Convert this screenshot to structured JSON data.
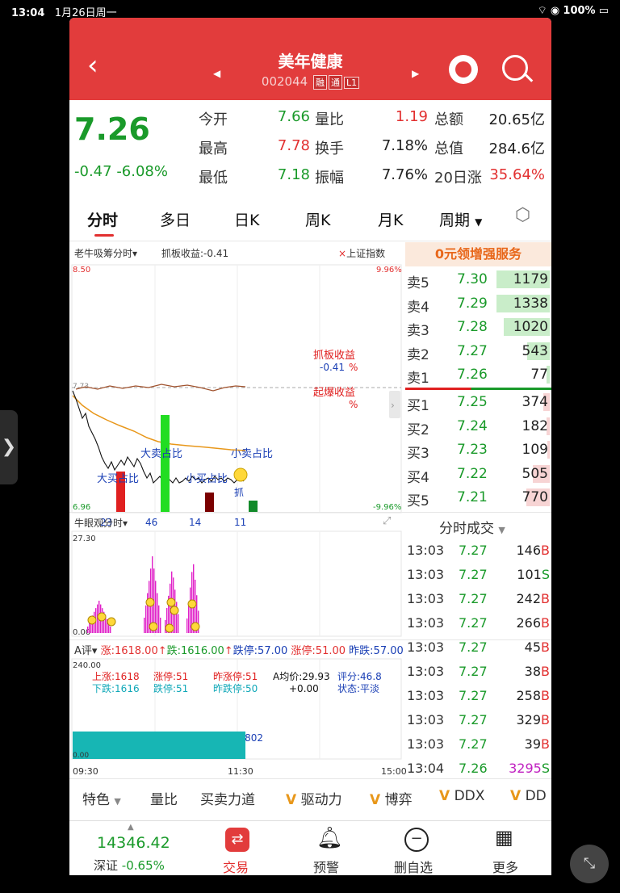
{
  "status_bar": {
    "time": "13:04",
    "date": "1月26日周一",
    "battery": "100%"
  },
  "header": {
    "title": "美年健康",
    "code": "002044",
    "badges": [
      "融",
      "通",
      "L1"
    ]
  },
  "quote": {
    "price": "7.26",
    "change": "-0.47",
    "change_pct": "-6.08%",
    "fields": [
      {
        "label": "今开",
        "value": "7.66",
        "color": "#1a9a2a"
      },
      {
        "label": "量比",
        "value": "1.19",
        "color": "#e23030"
      },
      {
        "label": "总额",
        "value": "20.65亿",
        "color": "#222222"
      },
      {
        "label": "最高",
        "value": "7.78",
        "color": "#e23030"
      },
      {
        "label": "换手",
        "value": "7.18%",
        "color": "#222222"
      },
      {
        "label": "总值",
        "value": "284.6亿",
        "color": "#222222"
      },
      {
        "label": "最低",
        "value": "7.18",
        "color": "#1a9a2a"
      },
      {
        "label": "振幅",
        "value": "7.76%",
        "color": "#222222"
      },
      {
        "label": "20日涨",
        "value": "35.64%",
        "color": "#e23030"
      }
    ]
  },
  "tabs": [
    "分时",
    "多日",
    "日K",
    "周K",
    "月K",
    "周期"
  ],
  "intraday": {
    "indicator_label": "老牛吸筹分时",
    "indicator_value": "抓板收益:-0.41",
    "index_label": "上证指数",
    "y_top": "8.50",
    "y_bottom": "6.96",
    "pct_top": "9.96%",
    "pct_bottom": "-9.96%",
    "mid_price": "7.73",
    "annot_zhuaban": "抓板收益",
    "annot_zhuaban_val": "-0.41",
    "annot_pct1": "%",
    "annot_qibao": "起爆收益",
    "annot_pct2": "%",
    "annot_large_sell": "大卖占比",
    "annot_small_sell": "小卖占比",
    "annot_large_buy": "大买占比",
    "annot_small_buy": "小买占比",
    "annot_zhua": "抓",
    "bar_values": [
      "23",
      "46",
      "14",
      "11"
    ]
  },
  "promo": "0元领增强服务",
  "order_book": {
    "sell": [
      {
        "label": "卖5",
        "price": "7.30",
        "volume": "1179",
        "fill": 0.95
      },
      {
        "label": "卖4",
        "price": "7.29",
        "volume": "1338",
        "fill": 0.95
      },
      {
        "label": "卖3",
        "price": "7.28",
        "volume": "1020",
        "fill": 0.82
      },
      {
        "label": "卖2",
        "price": "7.27",
        "volume": "543",
        "fill": 0.4
      },
      {
        "label": "卖1",
        "price": "7.26",
        "volume": "77",
        "fill": 0.06
      }
    ],
    "buy": [
      {
        "label": "买1",
        "price": "7.25",
        "volume": "374",
        "fill": 0.12
      },
      {
        "label": "买2",
        "price": "7.24",
        "volume": "182",
        "fill": 0.06
      },
      {
        "label": "买3",
        "price": "7.23",
        "volume": "109",
        "fill": 0.04
      },
      {
        "label": "买4",
        "price": "7.22",
        "volume": "505",
        "fill": 0.3
      },
      {
        "label": "买5",
        "price": "7.21",
        "volume": "770",
        "fill": 0.42
      }
    ]
  },
  "trades_title": "分时成交",
  "trades": [
    {
      "time": "13:03",
      "price": "7.27",
      "vol": "146",
      "side": "B"
    },
    {
      "time": "13:03",
      "price": "7.27",
      "vol": "101",
      "side": "S"
    },
    {
      "time": "13:03",
      "price": "7.27",
      "vol": "242",
      "side": "B"
    },
    {
      "time": "13:03",
      "price": "7.27",
      "vol": "266",
      "side": "B"
    },
    {
      "time": "13:03",
      "price": "7.27",
      "vol": "45",
      "side": "B"
    },
    {
      "time": "13:03",
      "price": "7.27",
      "vol": "38",
      "side": "B"
    },
    {
      "time": "13:03",
      "price": "7.27",
      "vol": "258",
      "side": "B"
    },
    {
      "time": "13:03",
      "price": "7.27",
      "vol": "329",
      "side": "B"
    },
    {
      "time": "13:03",
      "price": "7.27",
      "vol": "39",
      "side": "B"
    },
    {
      "time": "13:04",
      "price": "7.26",
      "vol": "3295",
      "side": "S"
    }
  ],
  "niuyan": {
    "label": "牛眼观分时",
    "y_top": "27.30",
    "y_bottom": "0.00"
  },
  "aping": {
    "label": "A评",
    "header_zhang": "涨:1618.00",
    "header_die": "跌:1616.00",
    "header_dieting": "跌停:57.00",
    "header_zhangting": "涨停:51.00",
    "header_zuodie": "昨跌:57.00",
    "y_top": "240.00",
    "y_bottom": "0.00",
    "shangzhang": "上涨:1618",
    "xiadie": "下跌:1616",
    "zhangting": "涨停:51",
    "dieting": "跌停:51",
    "zuozhangting": "昨涨停:51",
    "zuodieting": "昨跌停:50",
    "avg_price": "A均价:29.93",
    "avg_delta": "+0.00",
    "score": "评分:46.8",
    "state": "状态:平淡",
    "line_value": "46.802"
  },
  "time_axis": {
    "start": "09:30",
    "mid": "11:30",
    "end": "15:00"
  },
  "tools": [
    "特色",
    "量比",
    "买卖力道",
    "驱动力",
    "博弈",
    "DDX",
    "DD"
  ],
  "bottom_nav": {
    "index_value": "14346.42",
    "index_name": "深证",
    "index_pct": "-0.65%",
    "items": [
      "交易",
      "预警",
      "删自选",
      "更多"
    ]
  },
  "colors": {
    "brand": "#e23c3c",
    "up": "#e23030",
    "down": "#1a9a2a",
    "promo": "#e8671a"
  }
}
